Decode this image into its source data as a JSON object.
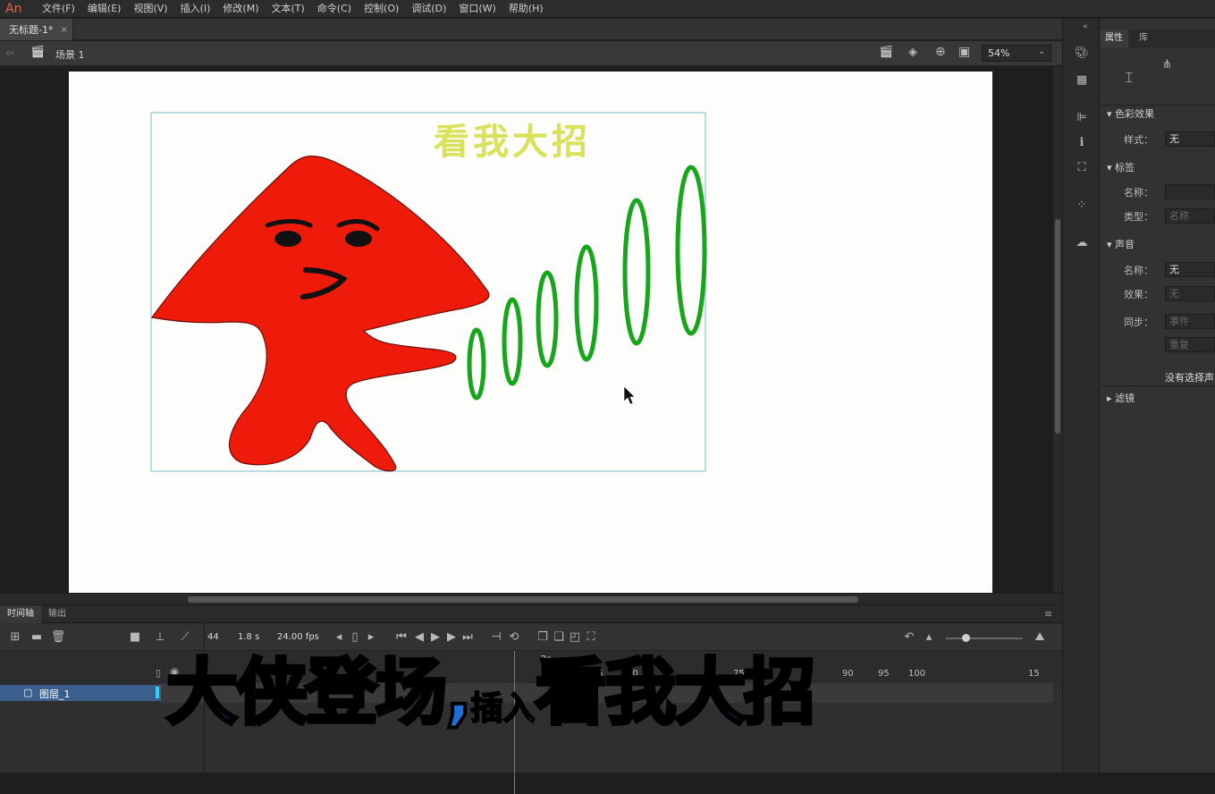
{
  "app": {
    "logo": "An"
  },
  "menu": [
    "文件(F)",
    "编辑(E)",
    "视图(V)",
    "插入(I)",
    "修改(M)",
    "文本(T)",
    "命令(C)",
    "控制(O)",
    "调试(D)",
    "窗口(W)",
    "帮助(H)"
  ],
  "document_tab": {
    "title": "无标题-1*",
    "close": "×"
  },
  "scene": {
    "label": "场景 1",
    "zoom": "54%"
  },
  "stage": {
    "banner_text": "看我大招",
    "colors": {
      "character": "#ee1b0b",
      "rings": "#17a51c",
      "banner": "#d8e25a",
      "frame": "#8fc7d2"
    }
  },
  "timeline": {
    "tabs": [
      "时间轴",
      "输出"
    ],
    "frame": "44",
    "time": "1.8 s",
    "fps": "24.00 fps",
    "ruler_marker": "2s",
    "ruler_ticks": [
      "50",
      "55",
      "60",
      "75",
      "90",
      "95",
      "100",
      "15"
    ],
    "layer_name": "图层_1"
  },
  "properties": {
    "tabs": [
      "属性",
      "库"
    ],
    "color_effect": {
      "header": "色彩效果",
      "style_label": "样式：",
      "style_value": "无"
    },
    "label": {
      "header": "标签",
      "name_label": "名称：",
      "name_value": "",
      "type_label": "类型：",
      "type_value": "名称"
    },
    "sound": {
      "header": "声音",
      "name_label": "名称：",
      "name_value": "无",
      "effect_label": "效果：",
      "effect_value": "无",
      "sync_label": "同步：",
      "sync_value": "事件",
      "repeat_value": "重复",
      "no_selection": "没有选择声"
    },
    "filters": {
      "header": "滤镜"
    }
  },
  "caption": {
    "part1": "大侠登场,",
    "part2": "插入",
    "part3": "看我大招"
  }
}
